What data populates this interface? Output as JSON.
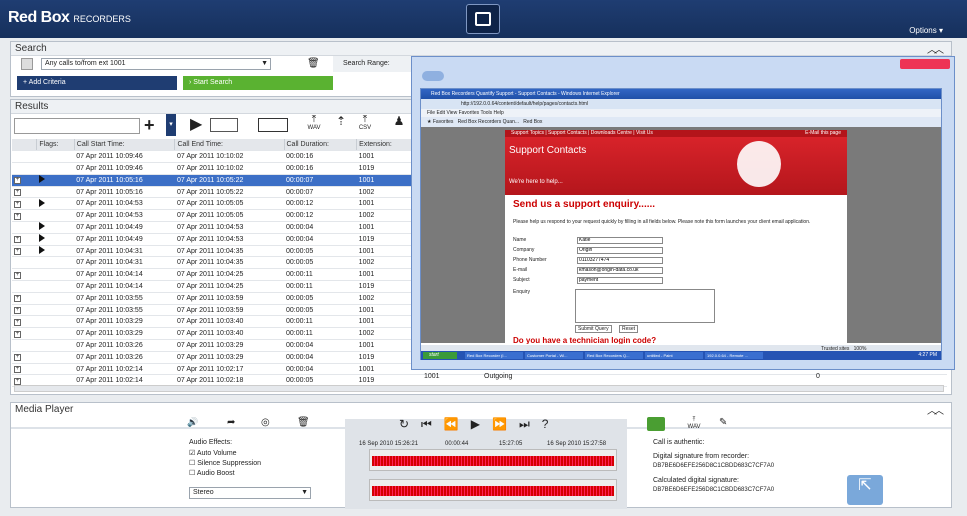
{
  "header": {
    "logo_main": "Red Box",
    "logo_sub": "RECORDERS",
    "options_label": "Options ▾"
  },
  "search": {
    "title": "Search",
    "filter_value": "Any calls to/from ext 1001",
    "range_label": "Search Range:",
    "add_criteria": "Add Criteria",
    "start_search": "Start Search"
  },
  "results": {
    "title": "Results",
    "toolbar": {
      "wav": "WAV",
      "csv": "CSV"
    },
    "columns": [
      "Flags:",
      "Call Start Time:",
      "Call End Time:",
      "Call Duration:",
      "Extension:"
    ],
    "rows": [
      {
        "exp": false,
        "play": false,
        "start": "07 Apr 2011 10:09:46",
        "end": "07 Apr 2011 10:10:02",
        "dur": "00:00:16",
        "ext": "1001",
        "hl": false
      },
      {
        "exp": false,
        "play": false,
        "start": "07 Apr 2011 10:09:46",
        "end": "07 Apr 2011 10:10:02",
        "dur": "00:00:16",
        "ext": "1019",
        "hl": false
      },
      {
        "exp": true,
        "play": true,
        "start": "07 Apr 2011 10:05:16",
        "end": "07 Apr 2011 10:05:22",
        "dur": "00:00:07",
        "ext": "1001",
        "hl": true
      },
      {
        "exp": true,
        "play": false,
        "start": "07 Apr 2011 10:05:16",
        "end": "07 Apr 2011 10:05:22",
        "dur": "00:00:07",
        "ext": "1002",
        "hl": false
      },
      {
        "exp": true,
        "play": true,
        "start": "07 Apr 2011 10:04:53",
        "end": "07 Apr 2011 10:05:05",
        "dur": "00:00:12",
        "ext": "1001",
        "hl": false
      },
      {
        "exp": true,
        "play": false,
        "start": "07 Apr 2011 10:04:53",
        "end": "07 Apr 2011 10:05:05",
        "dur": "00:00:12",
        "ext": "1002",
        "hl": false
      },
      {
        "exp": false,
        "play": true,
        "start": "07 Apr 2011 10:04:49",
        "end": "07 Apr 2011 10:04:53",
        "dur": "00:00:04",
        "ext": "1001",
        "hl": false
      },
      {
        "exp": true,
        "play": true,
        "start": "07 Apr 2011 10:04:49",
        "end": "07 Apr 2011 10:04:53",
        "dur": "00:00:04",
        "ext": "1019",
        "hl": false
      },
      {
        "exp": true,
        "play": true,
        "start": "07 Apr 2011 10:04:31",
        "end": "07 Apr 2011 10:04:35",
        "dur": "00:00:05",
        "ext": "1001",
        "hl": false
      },
      {
        "exp": false,
        "play": false,
        "start": "07 Apr 2011 10:04:31",
        "end": "07 Apr 2011 10:04:35",
        "dur": "00:00:05",
        "ext": "1002",
        "hl": false
      },
      {
        "exp": true,
        "play": false,
        "start": "07 Apr 2011 10:04:14",
        "end": "07 Apr 2011 10:04:25",
        "dur": "00:00:11",
        "ext": "1001",
        "hl": false
      },
      {
        "exp": false,
        "play": false,
        "start": "07 Apr 2011 10:04:14",
        "end": "07 Apr 2011 10:04:25",
        "dur": "00:00:11",
        "ext": "1019",
        "hl": false
      },
      {
        "exp": true,
        "play": false,
        "start": "07 Apr 2011 10:03:55",
        "end": "07 Apr 2011 10:03:59",
        "dur": "00:00:05",
        "ext": "1002",
        "hl": false
      },
      {
        "exp": true,
        "play": false,
        "start": "07 Apr 2011 10:03:55",
        "end": "07 Apr 2011 10:03:59",
        "dur": "00:00:05",
        "ext": "1001",
        "hl": false
      },
      {
        "exp": true,
        "play": false,
        "start": "07 Apr 2011 10:03:29",
        "end": "07 Apr 2011 10:03:40",
        "dur": "00:00:11",
        "ext": "1001",
        "hl": false
      },
      {
        "exp": true,
        "play": false,
        "start": "07 Apr 2011 10:03:29",
        "end": "07 Apr 2011 10:03:40",
        "dur": "00:00:11",
        "ext": "1002",
        "hl": false
      },
      {
        "exp": false,
        "play": false,
        "start": "07 Apr 2011 10:03:26",
        "end": "07 Apr 2011 10:03:29",
        "dur": "00:00:04",
        "ext": "1001",
        "hl": false
      },
      {
        "exp": true,
        "play": false,
        "start": "07 Apr 2011 10:03:26",
        "end": "07 Apr 2011 10:03:29",
        "dur": "00:00:04",
        "ext": "1019",
        "hl": false
      },
      {
        "exp": true,
        "play": false,
        "start": "07 Apr 2011 10:02:14",
        "end": "07 Apr 2011 10:02:17",
        "dur": "00:00:04",
        "ext": "1001",
        "hl": false
      },
      {
        "exp": true,
        "play": false,
        "start": "07 Apr 2011 10:02:14",
        "end": "07 Apr 2011 10:02:18",
        "dur": "00:00:05",
        "ext": "1019",
        "hl": false
      }
    ],
    "last_row_extra": {
      "party": "1001",
      "direction": "Outgoing",
      "count": "0"
    }
  },
  "browser": {
    "outer_title": "Red Box Recorders Quantify Support - Support Contacts - Windows Internet Explorer",
    "url": "http://192.0.0.64/content/default/help/pages/contacts.html",
    "tab1": "Red Box Recorders Quan...",
    "tab2": "Red Box",
    "page_links": "Support Topics | Support Contacts | Downloads Centre | Visit Us",
    "email_link": "E-Mail this page",
    "page_title": "Support Contacts",
    "tagline": "We're here to help...",
    "enquiry_heading": "Send us a support enquiry......",
    "enquiry_text": "Please help us respond to your request quickly by filling in all fields below. Please note this form launches your client email application.",
    "form": [
      {
        "label": "Name",
        "value": "Katie"
      },
      {
        "label": "Company",
        "value": "Origin"
      },
      {
        "label": "Phone Number",
        "value": "01103277474"
      },
      {
        "label": "E-mail",
        "value": "kmason@origin-data.co.uk"
      },
      {
        "label": "Subject",
        "value": "payment"
      }
    ],
    "enquiry_label": "Enquiry",
    "submit": "Submit Query",
    "reset": "Reset",
    "bottom_heading": "Do you have a technician login code?",
    "status_trusted": "Trusted sites",
    "zoom": "100%",
    "start": "start",
    "taskbar": [
      "Red Box Recorder (I...",
      "Customer Portal - Wi...",
      "Red Box Recorders Q...",
      "untitled - Paint",
      "192.0.0.64 - Remote ..."
    ],
    "clock": "4:27 PM"
  },
  "media": {
    "title": "Media Player",
    "audio_effects": "Audio Effects:",
    "auto_volume": "Auto Volume",
    "silence_suppression": "Silence Suppression",
    "audio_boost": "Audio Boost",
    "channel": "Stereo",
    "t_start": "16 Sep 2010 15:26:21",
    "t_mid1": "00:00:44",
    "t_mid2": "15:27:05",
    "t_end": "16 Sep 2010 15:27:58",
    "authentic": "Call is authentic:",
    "sig_recorder_label": "Digital signature from recorder:",
    "sig_recorder": "DB7BE6D6EFE256D8C1CBDD683C7CF7A0",
    "sig_calc_label": "Calculated digital signature:",
    "sig_calc": "DB7BE6D6EFE256D8C1CBDD683C7CF7A0",
    "wav": "WAV"
  }
}
